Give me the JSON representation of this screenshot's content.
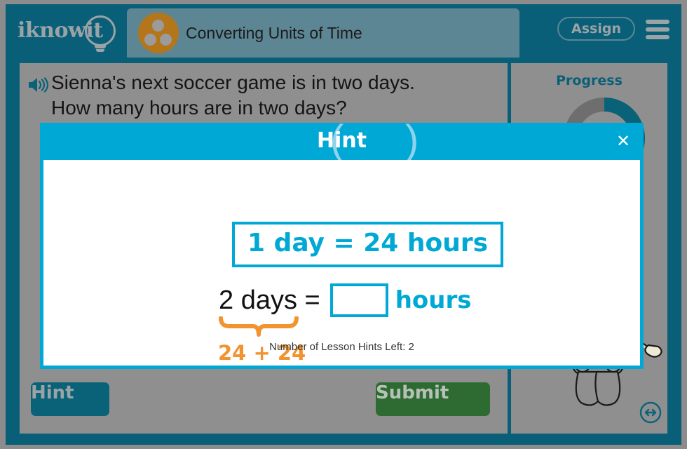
{
  "header": {
    "logo_text": "iknowit",
    "logo_icon": "lightbulb-icon",
    "avatar_icon": "three-dots-avatar-icon",
    "lesson_title": "Converting Units of Time",
    "assign_label": "Assign",
    "menu_icon": "hamburger-menu-icon"
  },
  "question": {
    "speaker_icon": "speaker-audio-icon",
    "line1": "Sienna's next soccer game is in two days.",
    "line2": "How many hours are in two days?"
  },
  "progress": {
    "label": "Progress",
    "percent": 45,
    "track_color": "#6e6e6e",
    "fill_color": "#0a6279"
  },
  "character": {
    "name": "astronaut-character-illustration",
    "resize_icon": "resize-horizontal-icon"
  },
  "footer": {
    "hint_label": "Hint",
    "submit_label": "Submit"
  },
  "hint_modal": {
    "title": "Hint",
    "paren_left": "(",
    "paren_right": ")",
    "close_icon": "✕",
    "equation": "1 day = 24 hours",
    "worked_lhs": "2 days  =",
    "blank_value": "",
    "unit_label": "hours",
    "breakdown": "24 + 24",
    "brace_icon": "curly-brace-icon",
    "hints_left_text": "Number of Lesson Hints Left: 2"
  },
  "colors": {
    "frame_teal": "#0a5f78",
    "content_grey": "#8f8f8f",
    "modal_cyan": "#00a8d5",
    "accent_orange": "#f2932f",
    "submit_green": "#2e6b32",
    "avatar_orange": "#b3761a"
  }
}
